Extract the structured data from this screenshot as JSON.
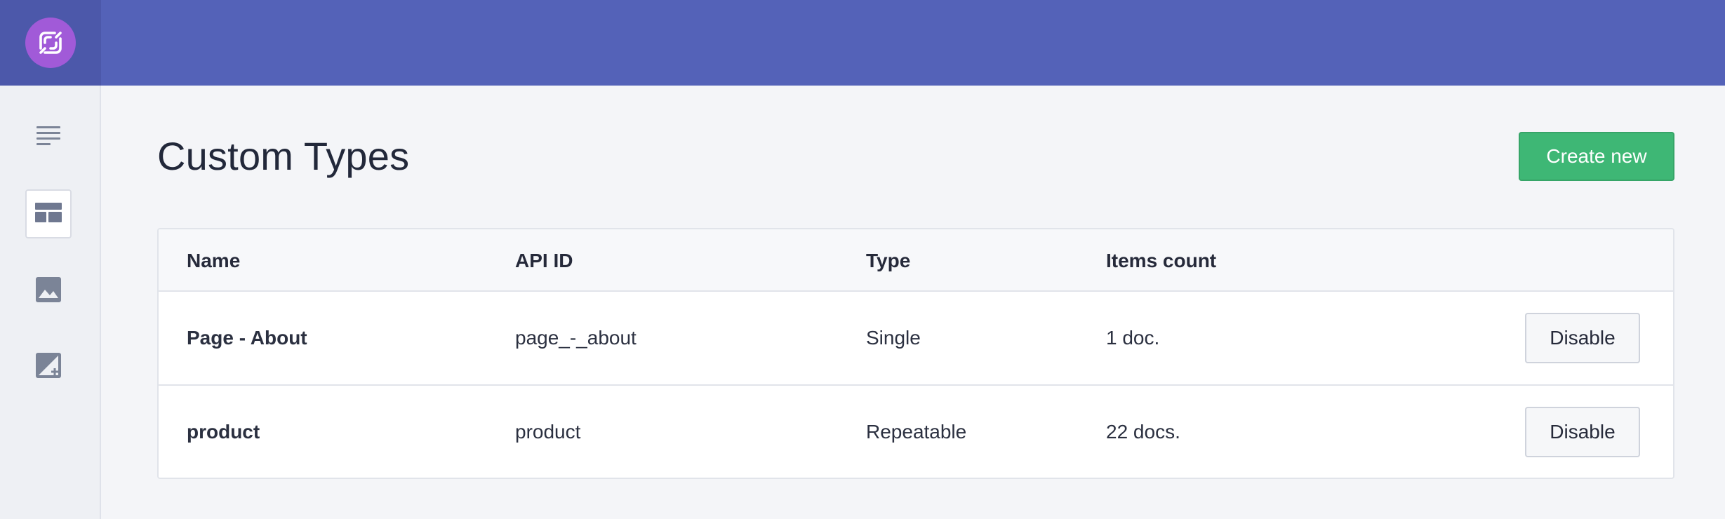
{
  "header": {
    "logo_icon": "prismic-logo-icon"
  },
  "sidebar": {
    "items": [
      {
        "icon": "list-icon",
        "active": false
      },
      {
        "icon": "custom-types-icon",
        "active": true
      },
      {
        "icon": "image-icon",
        "active": false
      },
      {
        "icon": "image-add-icon",
        "active": false
      }
    ]
  },
  "main": {
    "title": "Custom Types",
    "create_label": "Create new",
    "table": {
      "columns": [
        "Name",
        "API ID",
        "Type",
        "Items count"
      ],
      "rows": [
        {
          "name": "Page - About",
          "api_id": "page_-_about",
          "type": "Single",
          "count": "1 doc.",
          "action": "Disable"
        },
        {
          "name": "product",
          "api_id": "product",
          "type": "Repeatable",
          "count": "22 docs.",
          "action": "Disable"
        }
      ]
    }
  },
  "colors": {
    "topbar": "#5462b8",
    "logo": "#a15ad8",
    "accent_green": "#3eb775"
  }
}
